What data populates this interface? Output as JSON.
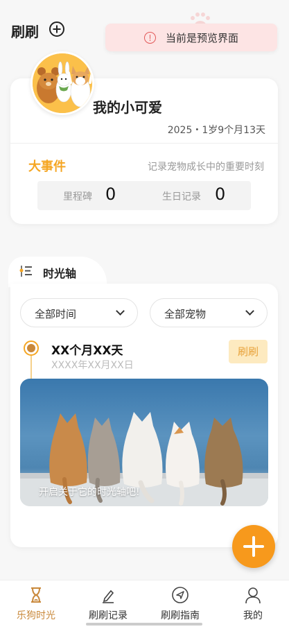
{
  "header": {
    "title": "刷刷",
    "add_icon": "add-circle-icon"
  },
  "toast": {
    "icon": "alert-circle-icon",
    "text": "当前是预览界面"
  },
  "pet_card": {
    "name": "我的小可爱",
    "age": "2025・1岁9个月13天",
    "events_title": "大事件",
    "events_subtitle": "记录宠物成长中的重要时刻",
    "milestone_label": "里程碑",
    "milestone_count": "0",
    "birthday_label": "生日记录",
    "birthday_count": "0"
  },
  "timeline": {
    "tab_label": "时光轴",
    "filter_time": "全部时间",
    "filter_pet": "全部宠物",
    "entry_title": "XX个月XX天",
    "entry_date": "XXXX年XX月XX日",
    "entry_pet": "刷刷",
    "photo_caption": "开启关于它的时光轴吧!"
  },
  "tabbar": {
    "items": [
      {
        "label": "乐狗时光",
        "icon": "hourglass-icon",
        "active": true
      },
      {
        "label": "刷刷记录",
        "icon": "pen-icon",
        "active": false
      },
      {
        "label": "刷刷指南",
        "icon": "compass-arrow-icon",
        "active": false
      },
      {
        "label": "我的",
        "icon": "person-icon",
        "active": false
      }
    ]
  },
  "colors": {
    "accent": "#f5a623",
    "fab": "#f7991c",
    "toast_bg": "#fde4e4",
    "alert": "#e25858"
  }
}
